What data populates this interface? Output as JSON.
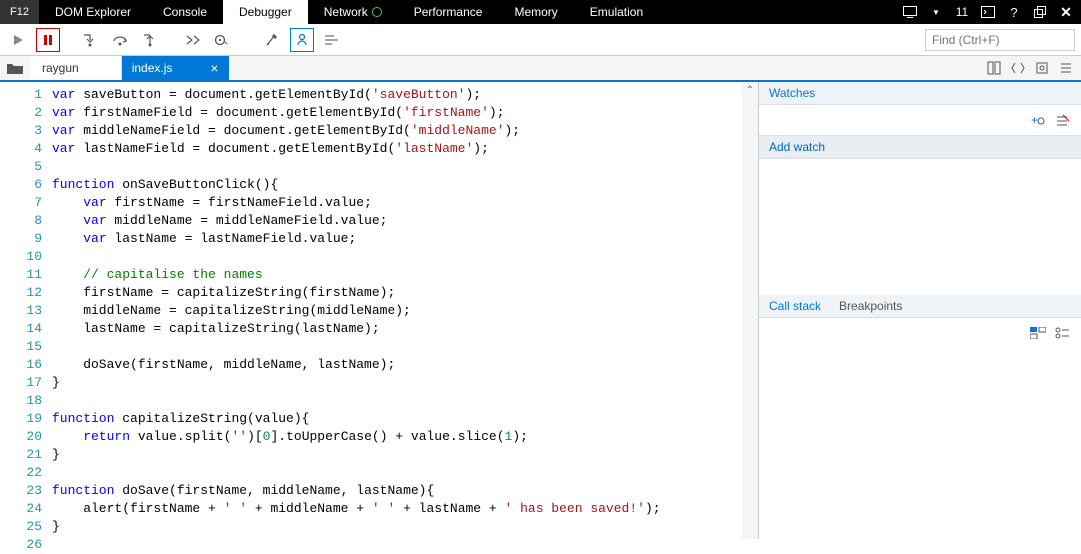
{
  "topbar": {
    "f12": "F12",
    "tabs": [
      "DOM Explorer",
      "Console",
      "Debugger",
      "Network",
      "Performance",
      "Memory",
      "Emulation"
    ],
    "active_tab": 2,
    "error_count": "11"
  },
  "toolbar": {
    "find_placeholder": "Find (Ctrl+F)"
  },
  "filebar": {
    "crumb": "raygun",
    "active_file": "index.js"
  },
  "side": {
    "watches_label": "Watches",
    "add_watch_label": "Add watch",
    "callstack_label": "Call stack",
    "breakpoints_label": "Breakpoints"
  },
  "code": {
    "lines": [
      [
        [
          "kw",
          "var"
        ],
        [
          "",
          " saveButton = document.getElementById("
        ],
        [
          "str",
          "'saveButton'"
        ],
        [
          "",
          ");"
        ]
      ],
      [
        [
          "kw",
          "var"
        ],
        [
          "",
          " firstNameField = document.getElementById("
        ],
        [
          "str",
          "'firstName'"
        ],
        [
          "",
          ");"
        ]
      ],
      [
        [
          "kw",
          "var"
        ],
        [
          "",
          " middleNameField = document.getElementById("
        ],
        [
          "str",
          "'middleName'"
        ],
        [
          "",
          ");"
        ]
      ],
      [
        [
          "kw",
          "var"
        ],
        [
          "",
          " lastNameField = document.getElementById("
        ],
        [
          "str",
          "'lastName'"
        ],
        [
          "",
          ");"
        ]
      ],
      [
        [
          "",
          ""
        ]
      ],
      [
        [
          "kw",
          "function"
        ],
        [
          "",
          " onSaveButtonClick(){"
        ]
      ],
      [
        [
          "",
          "    "
        ],
        [
          "kw",
          "var"
        ],
        [
          "",
          " firstName = firstNameField.value;"
        ]
      ],
      [
        [
          "",
          "    "
        ],
        [
          "kw",
          "var"
        ],
        [
          "",
          " middleName = middleNameField.value;"
        ]
      ],
      [
        [
          "",
          "    "
        ],
        [
          "kw",
          "var"
        ],
        [
          "",
          " lastName = lastNameField.value;"
        ]
      ],
      [
        [
          "",
          ""
        ]
      ],
      [
        [
          "",
          "    "
        ],
        [
          "cmt",
          "// capitalise the names"
        ]
      ],
      [
        [
          "",
          "    firstName = capitalizeString(firstName);"
        ]
      ],
      [
        [
          "",
          "    middleName = capitalizeString(middleName);"
        ]
      ],
      [
        [
          "",
          "    lastName = capitalizeString(lastName);"
        ]
      ],
      [
        [
          "",
          ""
        ]
      ],
      [
        [
          "",
          "    doSave(firstName, middleName, lastName);"
        ]
      ],
      [
        [
          "",
          "}"
        ]
      ],
      [
        [
          "",
          ""
        ]
      ],
      [
        [
          "kw",
          "function"
        ],
        [
          "",
          " capitalizeString(value){"
        ]
      ],
      [
        [
          "",
          "    "
        ],
        [
          "kw",
          "return"
        ],
        [
          "",
          " value.split("
        ],
        [
          "str",
          "''"
        ],
        [
          "",
          ")["
        ],
        [
          "num",
          "0"
        ],
        [
          "",
          "].toUpperCase() + value.slice("
        ],
        [
          "num",
          "1"
        ],
        [
          "",
          ");"
        ]
      ],
      [
        [
          "",
          "}"
        ]
      ],
      [
        [
          "",
          ""
        ]
      ],
      [
        [
          "kw",
          "function"
        ],
        [
          "",
          " doSave(firstName, middleName, lastName){"
        ]
      ],
      [
        [
          "",
          "    alert(firstName + "
        ],
        [
          "str",
          "' '"
        ],
        [
          "",
          " + middleName + "
        ],
        [
          "str",
          "' '"
        ],
        [
          "",
          " + lastName + "
        ],
        [
          "str",
          "' has been saved!'"
        ],
        [
          "",
          ");"
        ]
      ],
      [
        [
          "",
          "}"
        ]
      ],
      [
        [
          "",
          ""
        ]
      ]
    ]
  }
}
